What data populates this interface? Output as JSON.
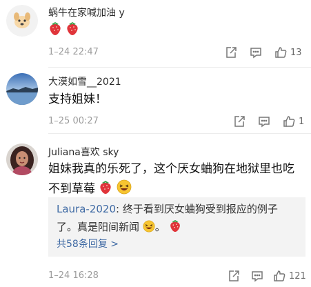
{
  "comments": [
    {
      "user": "蜗牛在家喊加油 y",
      "body": "",
      "time": "1–24 22:47",
      "likes": "13",
      "avatar_icon": "dog-avatar"
    },
    {
      "user": "大漠如雪__2021",
      "body": "支持姐妹！",
      "time": "1–25 00:27",
      "likes": "1",
      "avatar_icon": "lake-landscape-avatar"
    },
    {
      "user": "Juliana喜欢 sky",
      "body_line1": "姐妹我真的乐死了，这个厌女蛐狗在地狱里也吃",
      "body_line2": "不到草莓",
      "time": "1–24 16:28",
      "likes": "121",
      "avatar_icon": "woman-avatar",
      "reply": {
        "user": "Laura-2020",
        "text_line1": ": 终于看到厌女蛐狗受到报应的例子",
        "text_line2_a": "了。真是阳间新闻",
        "text_line2_b": "。",
        "more": "共58条回复 >"
      }
    }
  ],
  "colors": {
    "link": "#3f6aa4",
    "meta": "#9c9c9c",
    "strawberry": "#e0343a",
    "reply_bg": "#f3f3f3"
  },
  "icons": [
    "share-icon",
    "comment-icon",
    "like-icon",
    "strawberry-icon",
    "laughing-emoji-icon"
  ]
}
